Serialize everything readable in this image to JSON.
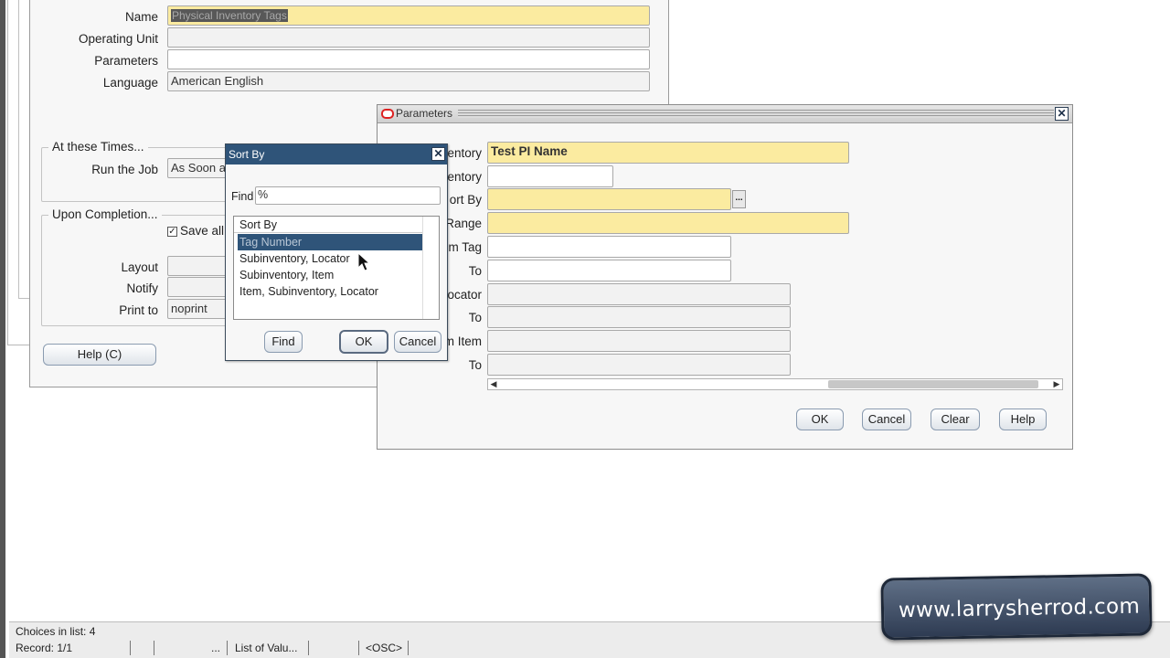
{
  "submit_window": {
    "name_label": "Name",
    "name_value": "Physical Inventory Tags",
    "operating_unit_label": "Operating Unit",
    "parameters_label": "Parameters",
    "language_label": "Language",
    "language_value": "American English",
    "times_group": "At these Times...",
    "run_job_label": "Run the Job",
    "run_job_value": "As Soon a",
    "completion_group": "Upon Completion...",
    "save_all_label": "Save all",
    "layout_label": "Layout",
    "notify_label": "Notify",
    "print_to_label": "Print to",
    "print_to_value": "noprint",
    "help_button": "Help (C)"
  },
  "sort_by_lov": {
    "title": "Sort By",
    "find_label": "Find",
    "find_value": "%",
    "column_header": "Sort By",
    "items": [
      "Tag Number",
      "Subinventory, Locator",
      "Subinventory, Item",
      "Item, Subinventory, Locator"
    ],
    "find_button": "Find",
    "ok_button": "OK",
    "cancel_button": "Cancel"
  },
  "parameters_window": {
    "title": "Parameters",
    "labels": [
      "ventory",
      "ventory",
      "ort By",
      "Range",
      "m Tag",
      "To",
      "ocator",
      "To",
      "m Item",
      "To"
    ],
    "inventory_value": "Test PI Name",
    "lov_button": "...",
    "ok_button": "OK",
    "cancel_button": "Cancel",
    "clear_button": "Clear",
    "help_button": "Help"
  },
  "status_bar": {
    "choices": "Choices in list: 4",
    "record": "Record: 1/1",
    "ellipsis": "...",
    "list_of_values": "List of Valu...",
    "osc": "<OSC>"
  },
  "watermark": {
    "text": "www.larrysherrod.com"
  },
  "colors": {
    "required_field": "#fbeba0",
    "title_bar_active": "#2f5479",
    "window_bg": "#f7f7f7"
  }
}
